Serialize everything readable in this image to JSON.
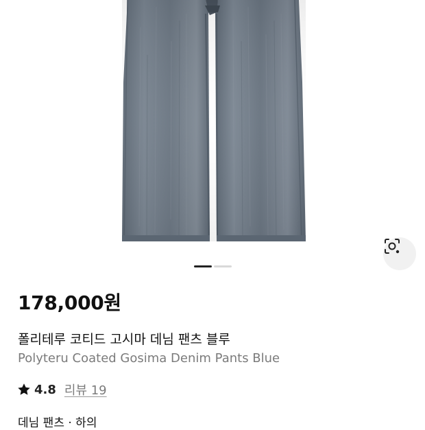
{
  "product": {
    "price": "178,000원",
    "name_ko": "폴리테루 코티드 고시마 데님 팬츠 블루",
    "name_en": "Polyteru Coated Gosima Denim Pants Blue",
    "rating": "4.8",
    "review_label": "리뷰 19",
    "category": "데님 팬츠 · 하의"
  },
  "gallery": {
    "total_images": 2,
    "current_index": 1,
    "lens_icon": "visual-search-icon"
  },
  "colors": {
    "denim": "#6b7784",
    "text_primary": "#111111",
    "text_secondary": "#7b7b7b",
    "indicator_active": "#222222",
    "indicator_inactive": "#d9d9d9"
  }
}
